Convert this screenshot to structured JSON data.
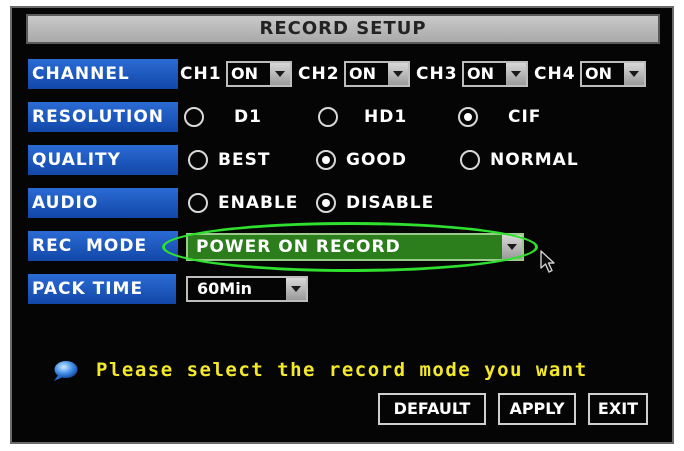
{
  "title": "RECORD SETUP",
  "channel": {
    "label": "CHANNEL",
    "items": [
      {
        "name": "CH1",
        "value": "ON"
      },
      {
        "name": "CH2",
        "value": "ON"
      },
      {
        "name": "CH3",
        "value": "ON"
      },
      {
        "name": "CH4",
        "value": "ON"
      }
    ]
  },
  "resolution": {
    "label": "RESOLUTION",
    "options": [
      "D1",
      "HD1",
      "CIF"
    ],
    "selected": "CIF"
  },
  "quality": {
    "label": "QUALITY",
    "options": [
      "BEST",
      "GOOD",
      "NORMAL"
    ],
    "selected": "GOOD"
  },
  "audio": {
    "label": "AUDIO",
    "options": [
      "ENABLE",
      "DISABLE"
    ],
    "selected": "DISABLE"
  },
  "rec_mode": {
    "label": "REC  MODE",
    "value": "POWER ON RECORD"
  },
  "pack_time": {
    "label": "PACK TIME",
    "value": "60Min"
  },
  "help_text": "Please select the record mode you want",
  "buttons": {
    "default": "DEFAULT",
    "apply": "APPLY",
    "exit": "EXIT"
  },
  "colors": {
    "label_bg": "#1a56bf",
    "highlight": "#2fe02f",
    "rec_mode_bg": "#2c7d1c",
    "help_text": "#f3e92a"
  }
}
